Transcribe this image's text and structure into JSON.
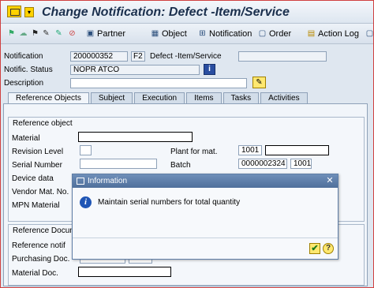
{
  "window": {
    "title": "Change Notification: Defect -Item/Service"
  },
  "toolbar": {
    "partner": "Partner",
    "object": "Object",
    "notification": "Notification",
    "order": "Order",
    "action_log": "Action Log"
  },
  "header": {
    "notification_label": "Notification",
    "notification_value": "200000352",
    "notification_type": "F2",
    "notification_type_text": "Defect -Item/Service",
    "status_label": "Notific. Status",
    "status_value": "NOPR ATCO",
    "description_label": "Description"
  },
  "tabs": [
    "Reference Objects",
    "Subject",
    "Execution",
    "Items",
    "Tasks",
    "Activities"
  ],
  "reference_object": {
    "title": "Reference object",
    "material": "Material",
    "revision_level": "Revision Level",
    "plant_for_mat": "Plant for mat.",
    "plant_value": "1001",
    "serial_number": "Serial Number",
    "batch": "Batch",
    "batch_value": "0000002324",
    "batch_plant": "1001",
    "device_data": "Device data",
    "vendor_mat_no": "Vendor Mat. No.",
    "mpn_material": "MPN Material"
  },
  "reference_docs": {
    "title": "Reference Docum",
    "reference_notif": "Reference notif",
    "purchasing_doc": "Purchasing Doc.",
    "material_doc": "Material Doc."
  },
  "dialog": {
    "title": "Information",
    "message": "Maintain serial numbers for total quantity"
  }
}
